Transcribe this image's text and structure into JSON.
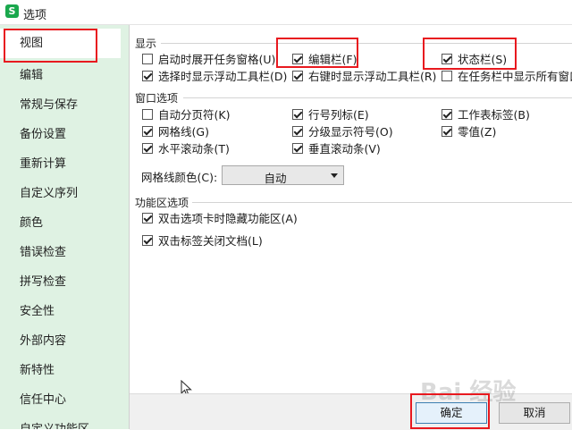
{
  "window": {
    "title": "选项",
    "app_icon_letter": "S"
  },
  "sidebar": {
    "items": [
      {
        "label": "视图",
        "active": true
      },
      {
        "label": "编辑"
      },
      {
        "label": "常规与保存"
      },
      {
        "label": "备份设置"
      },
      {
        "label": "重新计算"
      },
      {
        "label": "自定义序列"
      },
      {
        "label": "颜色"
      },
      {
        "label": "错误检查"
      },
      {
        "label": "拼写检查"
      },
      {
        "label": "安全性"
      },
      {
        "label": "外部内容"
      },
      {
        "label": "新特性"
      },
      {
        "label": "信任中心"
      },
      {
        "label": "自定义功能区"
      }
    ]
  },
  "display": {
    "label": "显示",
    "options": [
      {
        "label": "启动时展开任务窗格(U)",
        "checked": false
      },
      {
        "label": "编辑栏(F)",
        "checked": true
      },
      {
        "label": "状态栏(S)",
        "checked": true
      },
      {
        "label": "选择时显示浮动工具栏(D)",
        "checked": true
      },
      {
        "label": "右键时显示浮动工具栏(R)",
        "checked": true
      },
      {
        "label": "在任务栏中显示所有窗口",
        "checked": false
      }
    ]
  },
  "window_options": {
    "label": "窗口选项",
    "options": [
      {
        "label": "自动分页符(K)",
        "checked": false
      },
      {
        "label": "行号列标(E)",
        "checked": true
      },
      {
        "label": "工作表标签(B)",
        "checked": true
      },
      {
        "label": "网格线(G)",
        "checked": true
      },
      {
        "label": "分级显示符号(O)",
        "checked": true
      },
      {
        "label": "零值(Z)",
        "checked": true
      },
      {
        "label": "水平滚动条(T)",
        "checked": true
      },
      {
        "label": "垂直滚动条(V)",
        "checked": true
      }
    ],
    "grid_color_label": "网格线颜色(C):",
    "grid_color_value": "自动"
  },
  "ribbon_options": {
    "label": "功能区选项",
    "options": [
      {
        "label": "双击选项卡时隐藏功能区(A)",
        "checked": true
      },
      {
        "label": "双击标签关闭文档(L)",
        "checked": true
      }
    ]
  },
  "footer": {
    "ok_label": "确定",
    "cancel_label": "取消"
  },
  "watermark": "Bai 经验",
  "colors": {
    "highlight": "#e8191f",
    "sidebar_bg": "#dff2e3",
    "app_icon": "#1aa84d"
  }
}
